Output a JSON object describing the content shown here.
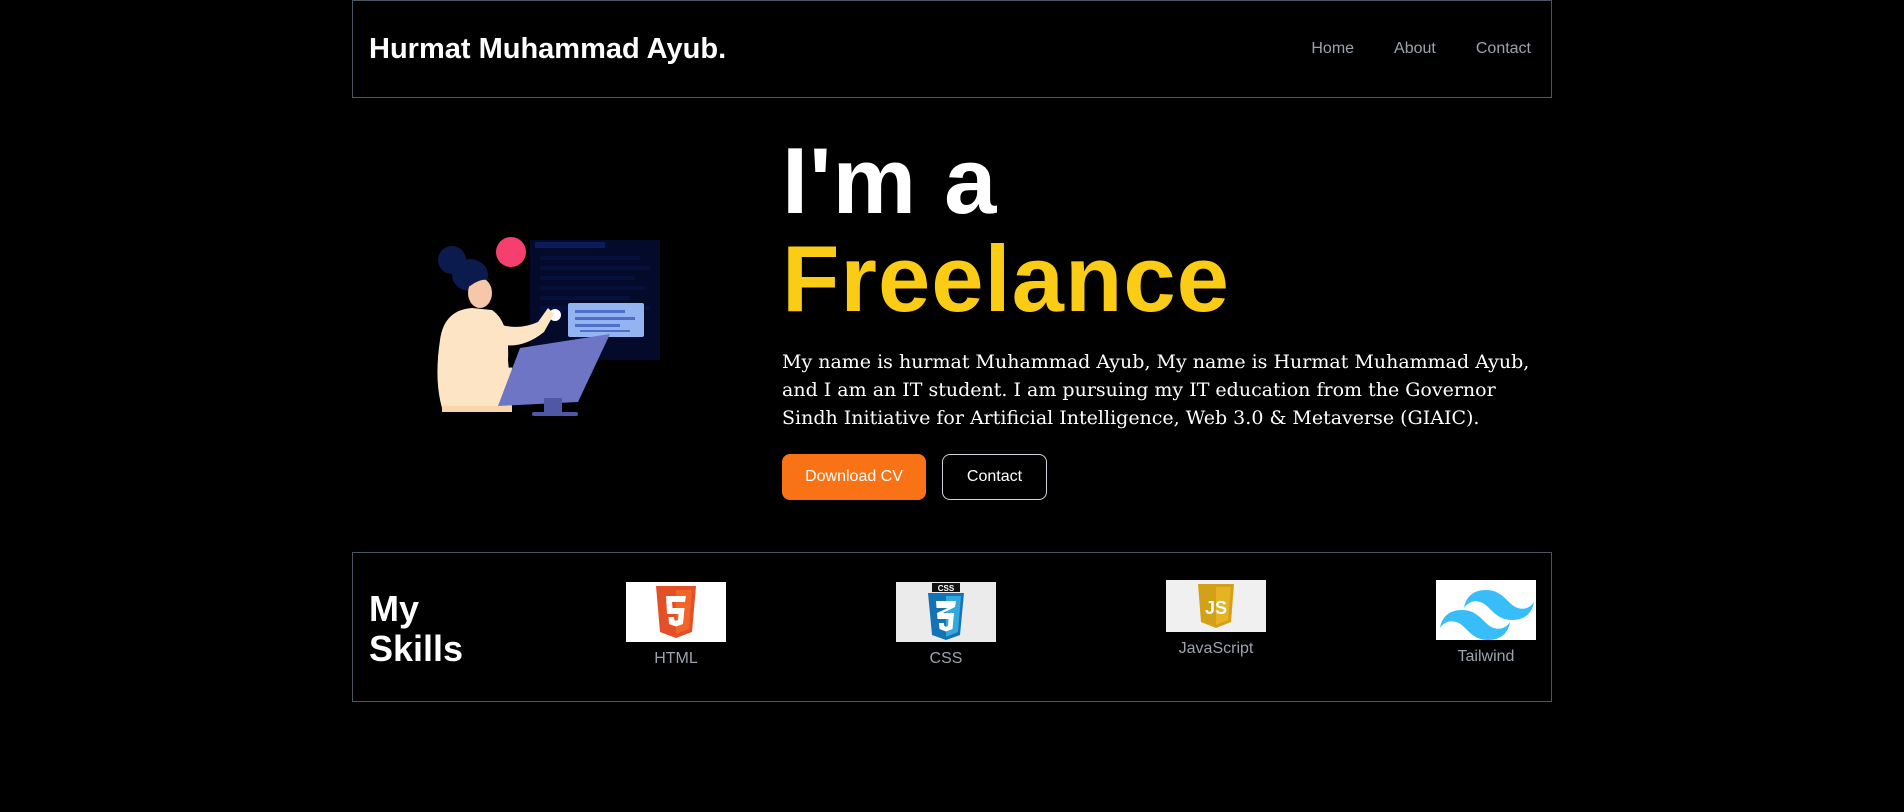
{
  "header": {
    "brand": "Hurmat Muhammad Ayub.",
    "nav": [
      {
        "label": "Home"
      },
      {
        "label": "About"
      },
      {
        "label": "Contact"
      }
    ]
  },
  "hero": {
    "line1": "I'm a",
    "line2": "Freelance",
    "description": "My name is hurmat Muhammad Ayub, My name is Hurmat Muhammad Ayub, and I am an IT student. I am pursuing my IT education from the Governor Sindh Initiative for Artificial Intelligence, Web 3.0 & Metaverse (GIAIC).",
    "download_button": "Download CV",
    "contact_button": "Contact"
  },
  "skills": {
    "title_line1": "My",
    "title_line2": "Skills",
    "items": [
      {
        "label": "HTML",
        "icon": "html5-logo-icon"
      },
      {
        "label": "CSS",
        "icon": "css3-logo-icon"
      },
      {
        "label": "JavaScript",
        "icon": "javascript-logo-icon"
      },
      {
        "label": "Tailwind",
        "icon": "tailwind-logo-icon"
      }
    ]
  },
  "colors": {
    "background": "#000000",
    "accent_yellow": "#facc15",
    "accent_orange": "#f97316",
    "border": "#4b5563",
    "muted_text": "#9ca3af"
  }
}
